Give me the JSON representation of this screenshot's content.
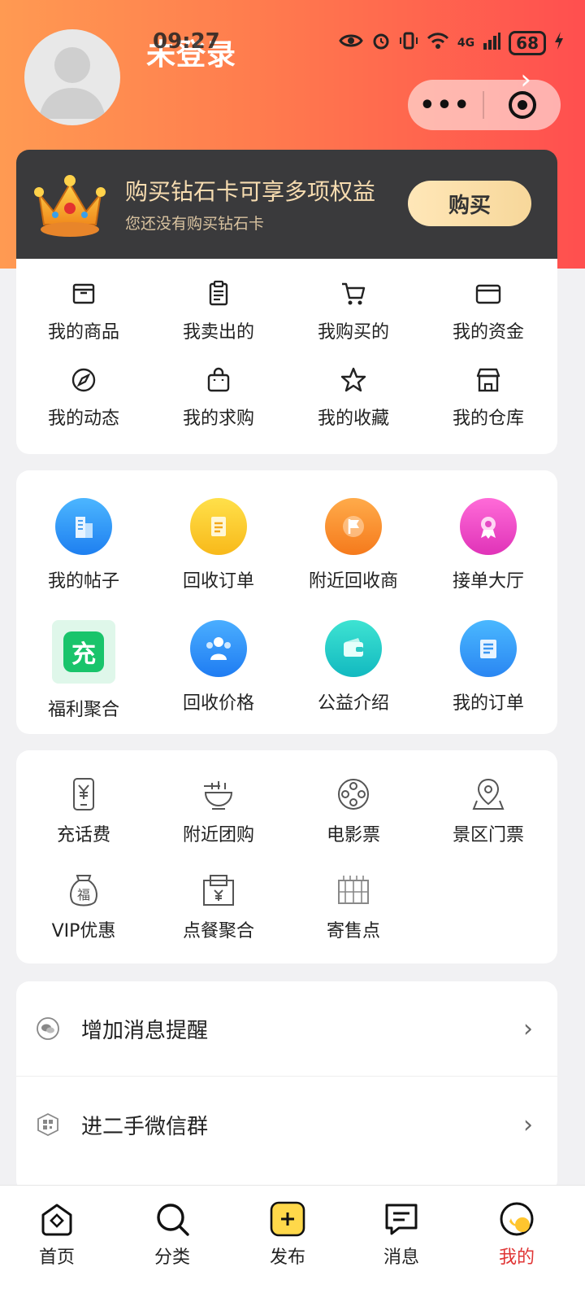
{
  "status_bar": {
    "time": "09:27",
    "signal": "4G",
    "battery": "68"
  },
  "header": {
    "login_title": "未登录"
  },
  "capsule": {
    "more": "•••"
  },
  "diamond": {
    "title": "购买钻石卡可享多项权益",
    "subtitle": "您还没有购买钻石卡",
    "buy_label": "购买"
  },
  "quick_menu": [
    {
      "label": "我的商品",
      "icon": "box-icon"
    },
    {
      "label": "我卖出的",
      "icon": "clipboard-icon"
    },
    {
      "label": "我购买的",
      "icon": "cart-icon"
    },
    {
      "label": "我的资金",
      "icon": "wallet-icon"
    },
    {
      "label": "我的动态",
      "icon": "compass-icon"
    },
    {
      "label": "我的求购",
      "icon": "bag-icon"
    },
    {
      "label": "我的收藏",
      "icon": "star-icon"
    },
    {
      "label": "我的仓库",
      "icon": "store-icon"
    }
  ],
  "services": [
    {
      "label": "我的帖子",
      "icon": "building-icon"
    },
    {
      "label": "回收订单",
      "icon": "notepad-icon"
    },
    {
      "label": "附近回收商",
      "icon": "flag-icon"
    },
    {
      "label": "接单大厅",
      "icon": "award-icon"
    },
    {
      "label": "福利聚合",
      "icon": "recharge-icon",
      "glyph": "充"
    },
    {
      "label": "回收价格",
      "icon": "people-icon"
    },
    {
      "label": "公益介绍",
      "icon": "purse-icon"
    },
    {
      "label": "我的订单",
      "icon": "document-icon"
    }
  ],
  "life": [
    {
      "label": "充话费",
      "icon": "phone-yuan-icon"
    },
    {
      "label": "附近团购",
      "icon": "bowl-icon"
    },
    {
      "label": "电影票",
      "icon": "film-reel-icon"
    },
    {
      "label": "景区门票",
      "icon": "location-pin-icon"
    },
    {
      "label": "VIP优惠",
      "icon": "fortune-bag-icon",
      "glyph": "福"
    },
    {
      "label": "点餐聚合",
      "icon": "coupon-yuan-icon"
    },
    {
      "label": "寄售点",
      "icon": "shelf-icon"
    }
  ],
  "list": [
    {
      "label": "增加消息提醒",
      "icon": "wechat-icon"
    },
    {
      "label": "进二手微信群",
      "icon": "qrcode-icon"
    }
  ],
  "tabs": [
    {
      "label": "首页",
      "icon": "home-icon"
    },
    {
      "label": "分类",
      "icon": "search-icon"
    },
    {
      "label": "发布",
      "icon": "publish-icon"
    },
    {
      "label": "消息",
      "icon": "message-icon"
    },
    {
      "label": "我的",
      "icon": "profile-icon",
      "active": true
    }
  ],
  "colors": {
    "header_start": "#ff9a52",
    "header_end": "#ff4f4f",
    "diamond_bg": "#3a3a3c",
    "gold_text": "#f7dcb0",
    "active_tab": "#e03535"
  }
}
